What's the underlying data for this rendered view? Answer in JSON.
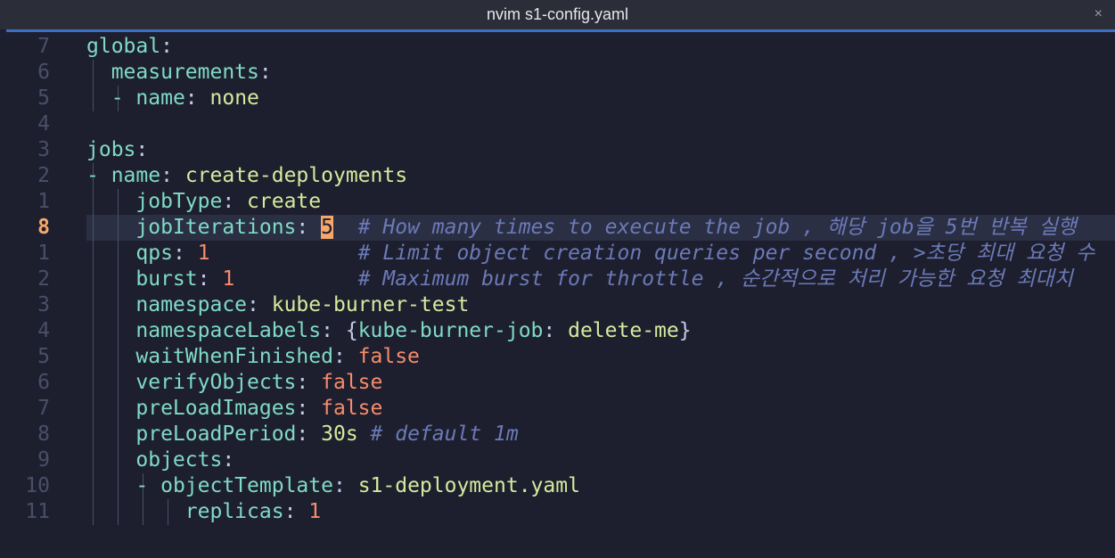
{
  "window": {
    "title": "nvim s1-config.yaml",
    "close_label": "×"
  },
  "lines": [
    {
      "num": "7",
      "indent": 0,
      "key": "global",
      "colon": ":",
      "value": "",
      "value_type": "",
      "comment": ""
    },
    {
      "num": "6",
      "indent": 1,
      "key": "measurements",
      "colon": ":",
      "value": "",
      "value_type": "",
      "comment": ""
    },
    {
      "num": "5",
      "indent": 2,
      "dash": "- ",
      "key": "name",
      "colon": ":",
      "value": "none",
      "value_type": "string",
      "comment": ""
    },
    {
      "num": "4",
      "indent": 0,
      "key": "",
      "colon": "",
      "value": "",
      "value_type": "",
      "comment": ""
    },
    {
      "num": "3",
      "indent": 0,
      "key": "jobs",
      "colon": ":",
      "value": "",
      "value_type": "",
      "comment": ""
    },
    {
      "num": "2",
      "indent": 1,
      "dash": "- ",
      "key": "name",
      "colon": ":",
      "value": "create-deployments",
      "value_type": "string",
      "comment": ""
    },
    {
      "num": "1",
      "indent": 2,
      "key": "jobType",
      "colon": ":",
      "value": "create",
      "value_type": "string",
      "comment": ""
    },
    {
      "num": "8",
      "indent": 2,
      "key": "jobIterations",
      "colon": ":",
      "value": "5",
      "value_type": "number",
      "comment": "# How many times to execute the job , 해당 job을 5번 반복 실행"
    },
    {
      "num": "1",
      "indent": 2,
      "key": "qps",
      "colon": ":",
      "value": "1",
      "value_type": "number",
      "comment": "# Limit object creation queries per second , >초당 최대 요청 수"
    },
    {
      "num": "2",
      "indent": 2,
      "key": "burst",
      "colon": ":",
      "value": "1",
      "value_type": "number",
      "comment": "# Maximum burst for throttle , 순간적으로 처리 가능한 요청 최대치"
    },
    {
      "num": "3",
      "indent": 2,
      "key": "namespace",
      "colon": ":",
      "value": "kube-burner-test",
      "value_type": "string",
      "comment": ""
    },
    {
      "num": "4",
      "indent": 2,
      "key": "namespaceLabels",
      "colon": ":",
      "value": "{kube-burner-job: delete-me}",
      "value_type": "map",
      "comment": ""
    },
    {
      "num": "5",
      "indent": 2,
      "key": "waitWhenFinished",
      "colon": ":",
      "value": "false",
      "value_type": "bool",
      "comment": ""
    },
    {
      "num": "6",
      "indent": 2,
      "key": "verifyObjects",
      "colon": ":",
      "value": "false",
      "value_type": "bool",
      "comment": ""
    },
    {
      "num": "7",
      "indent": 2,
      "key": "preLoadImages",
      "colon": ":",
      "value": "false",
      "value_type": "bool",
      "comment": ""
    },
    {
      "num": "8",
      "indent": 2,
      "key": "preLoadPeriod",
      "colon": ":",
      "value": "30s",
      "value_type": "string",
      "comment": "# default 1m"
    },
    {
      "num": "9",
      "indent": 2,
      "key": "objects",
      "colon": ":",
      "value": "",
      "value_type": "",
      "comment": ""
    },
    {
      "num": "10",
      "indent": 3,
      "dash": "- ",
      "key": "objectTemplate",
      "colon": ":",
      "value": "s1-deployment.yaml",
      "value_type": "string",
      "comment": ""
    },
    {
      "num": "11",
      "indent": 4,
      "key": "replicas",
      "colon": ":",
      "value": "1",
      "value_type": "number",
      "comment": ""
    }
  ],
  "colors": {
    "background": "#1e1f2e",
    "key": "#7fdac6",
    "string": "#d4ea9e",
    "number": "#f68c6b",
    "comment": "#6b7ab8",
    "current_line_number": "#f6a86b",
    "accent": "#3b6fc4"
  }
}
